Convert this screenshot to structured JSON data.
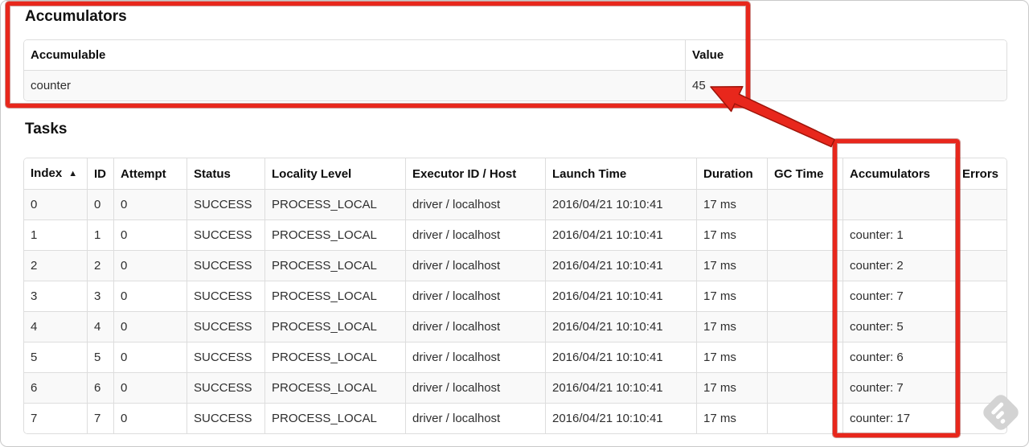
{
  "accumulators_section": {
    "title": "Accumulators",
    "table": {
      "headers": [
        "Accumulable",
        "Value"
      ],
      "rows": [
        [
          "counter",
          "45"
        ]
      ]
    }
  },
  "tasks_section": {
    "title": "Tasks",
    "table": {
      "headers": [
        "Index",
        "ID",
        "Attempt",
        "Status",
        "Locality Level",
        "Executor ID / Host",
        "Launch Time",
        "Duration",
        "GC Time",
        "Accumulators",
        "Errors"
      ],
      "sort": {
        "column_index": 0,
        "direction": "ascending",
        "glyph": "▲"
      },
      "rows": [
        [
          "0",
          "0",
          "0",
          "SUCCESS",
          "PROCESS_LOCAL",
          "driver / localhost",
          "2016/04/21 10:10:41",
          "17 ms",
          "",
          "",
          ""
        ],
        [
          "1",
          "1",
          "0",
          "SUCCESS",
          "PROCESS_LOCAL",
          "driver / localhost",
          "2016/04/21 10:10:41",
          "17 ms",
          "",
          "counter: 1",
          ""
        ],
        [
          "2",
          "2",
          "0",
          "SUCCESS",
          "PROCESS_LOCAL",
          "driver / localhost",
          "2016/04/21 10:10:41",
          "17 ms",
          "",
          "counter: 2",
          ""
        ],
        [
          "3",
          "3",
          "0",
          "SUCCESS",
          "PROCESS_LOCAL",
          "driver / localhost",
          "2016/04/21 10:10:41",
          "17 ms",
          "",
          "counter: 7",
          ""
        ],
        [
          "4",
          "4",
          "0",
          "SUCCESS",
          "PROCESS_LOCAL",
          "driver / localhost",
          "2016/04/21 10:10:41",
          "17 ms",
          "",
          "counter: 5",
          ""
        ],
        [
          "5",
          "5",
          "0",
          "SUCCESS",
          "PROCESS_LOCAL",
          "driver / localhost",
          "2016/04/21 10:10:41",
          "17 ms",
          "",
          "counter: 6",
          ""
        ],
        [
          "6",
          "6",
          "0",
          "SUCCESS",
          "PROCESS_LOCAL",
          "driver / localhost",
          "2016/04/21 10:10:41",
          "17 ms",
          "",
          "counter: 7",
          ""
        ],
        [
          "7",
          "7",
          "0",
          "SUCCESS",
          "PROCESS_LOCAL",
          "driver / localhost",
          "2016/04/21 10:10:41",
          "17 ms",
          "",
          "counter: 17",
          ""
        ]
      ]
    }
  },
  "annotations": {
    "color": "#e8271c",
    "boxed_regions": [
      "Accumulators section",
      "Accumulators column"
    ],
    "arrow_points_to": "45"
  },
  "watermark": {
    "name": "skitch-logo",
    "color": "#d3d3d3"
  }
}
